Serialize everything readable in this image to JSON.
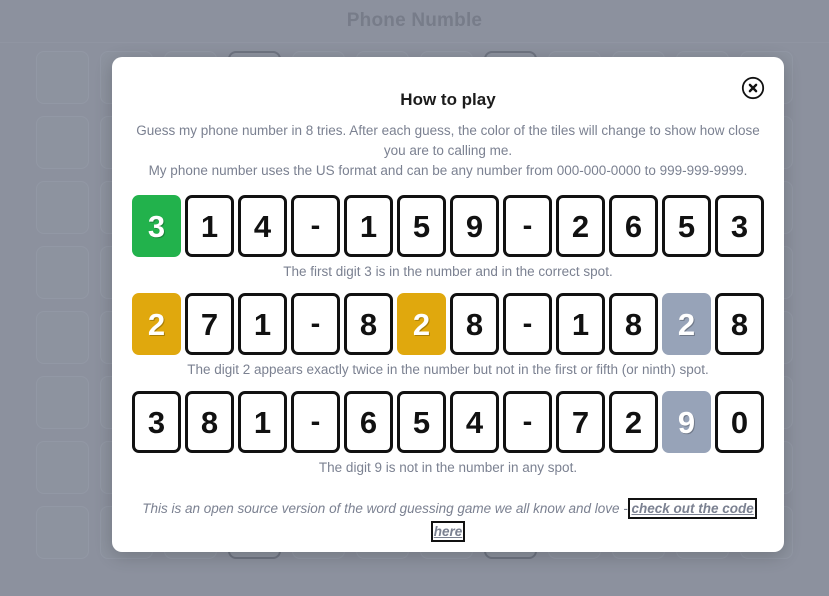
{
  "app": {
    "title": "Phone Numble",
    "board": {
      "rows": 8,
      "columns": 12,
      "separator_positions": [
        3,
        7
      ],
      "separator_glyph": "-"
    }
  },
  "modal": {
    "title": "How to play",
    "close_icon": "close-circle-icon",
    "intro_line_1": "Guess my phone number in 8 tries. After each guess, the color of the tiles will change to show how close you are to calling me.",
    "intro_line_2": "My phone number uses the US format and can be any number from 000-000-0000 to 999-999-9999.",
    "examples": [
      {
        "tiles": [
          {
            "value": "3",
            "state": "green"
          },
          {
            "value": "1",
            "state": "empty"
          },
          {
            "value": "4",
            "state": "empty"
          },
          {
            "value": "-",
            "state": "empty"
          },
          {
            "value": "1",
            "state": "empty"
          },
          {
            "value": "5",
            "state": "empty"
          },
          {
            "value": "9",
            "state": "empty"
          },
          {
            "value": "-",
            "state": "empty"
          },
          {
            "value": "2",
            "state": "empty"
          },
          {
            "value": "6",
            "state": "empty"
          },
          {
            "value": "5",
            "state": "empty"
          },
          {
            "value": "3",
            "state": "empty"
          }
        ],
        "caption": "The first digit 3 is in the number and in the correct spot."
      },
      {
        "tiles": [
          {
            "value": "2",
            "state": "yellow"
          },
          {
            "value": "7",
            "state": "empty"
          },
          {
            "value": "1",
            "state": "empty"
          },
          {
            "value": "-",
            "state": "empty"
          },
          {
            "value": "8",
            "state": "empty"
          },
          {
            "value": "2",
            "state": "yellow"
          },
          {
            "value": "8",
            "state": "empty"
          },
          {
            "value": "-",
            "state": "empty"
          },
          {
            "value": "1",
            "state": "empty"
          },
          {
            "value": "8",
            "state": "empty"
          },
          {
            "value": "2",
            "state": "gray"
          },
          {
            "value": "8",
            "state": "empty"
          }
        ],
        "caption": "The digit 2 appears exactly twice in the number but not in the first or fifth (or ninth) spot."
      },
      {
        "tiles": [
          {
            "value": "3",
            "state": "empty"
          },
          {
            "value": "8",
            "state": "empty"
          },
          {
            "value": "1",
            "state": "empty"
          },
          {
            "value": "-",
            "state": "empty"
          },
          {
            "value": "6",
            "state": "empty"
          },
          {
            "value": "5",
            "state": "empty"
          },
          {
            "value": "4",
            "state": "empty"
          },
          {
            "value": "-",
            "state": "empty"
          },
          {
            "value": "7",
            "state": "empty"
          },
          {
            "value": "2",
            "state": "empty"
          },
          {
            "value": "9",
            "state": "gray"
          },
          {
            "value": "0",
            "state": "empty"
          }
        ],
        "caption": "The digit 9 is not in the number in any spot."
      }
    ],
    "footer_text": "This is an open source version of the word guessing game we all know and love - ",
    "footer_link_text": "check out the code here"
  },
  "colors": {
    "correct": "#22b24c",
    "present": "#e0a80d",
    "absent": "#97a3b8",
    "page_background": "#8c919e",
    "tile_border": "#111111",
    "muted_text": "#7b8191"
  }
}
